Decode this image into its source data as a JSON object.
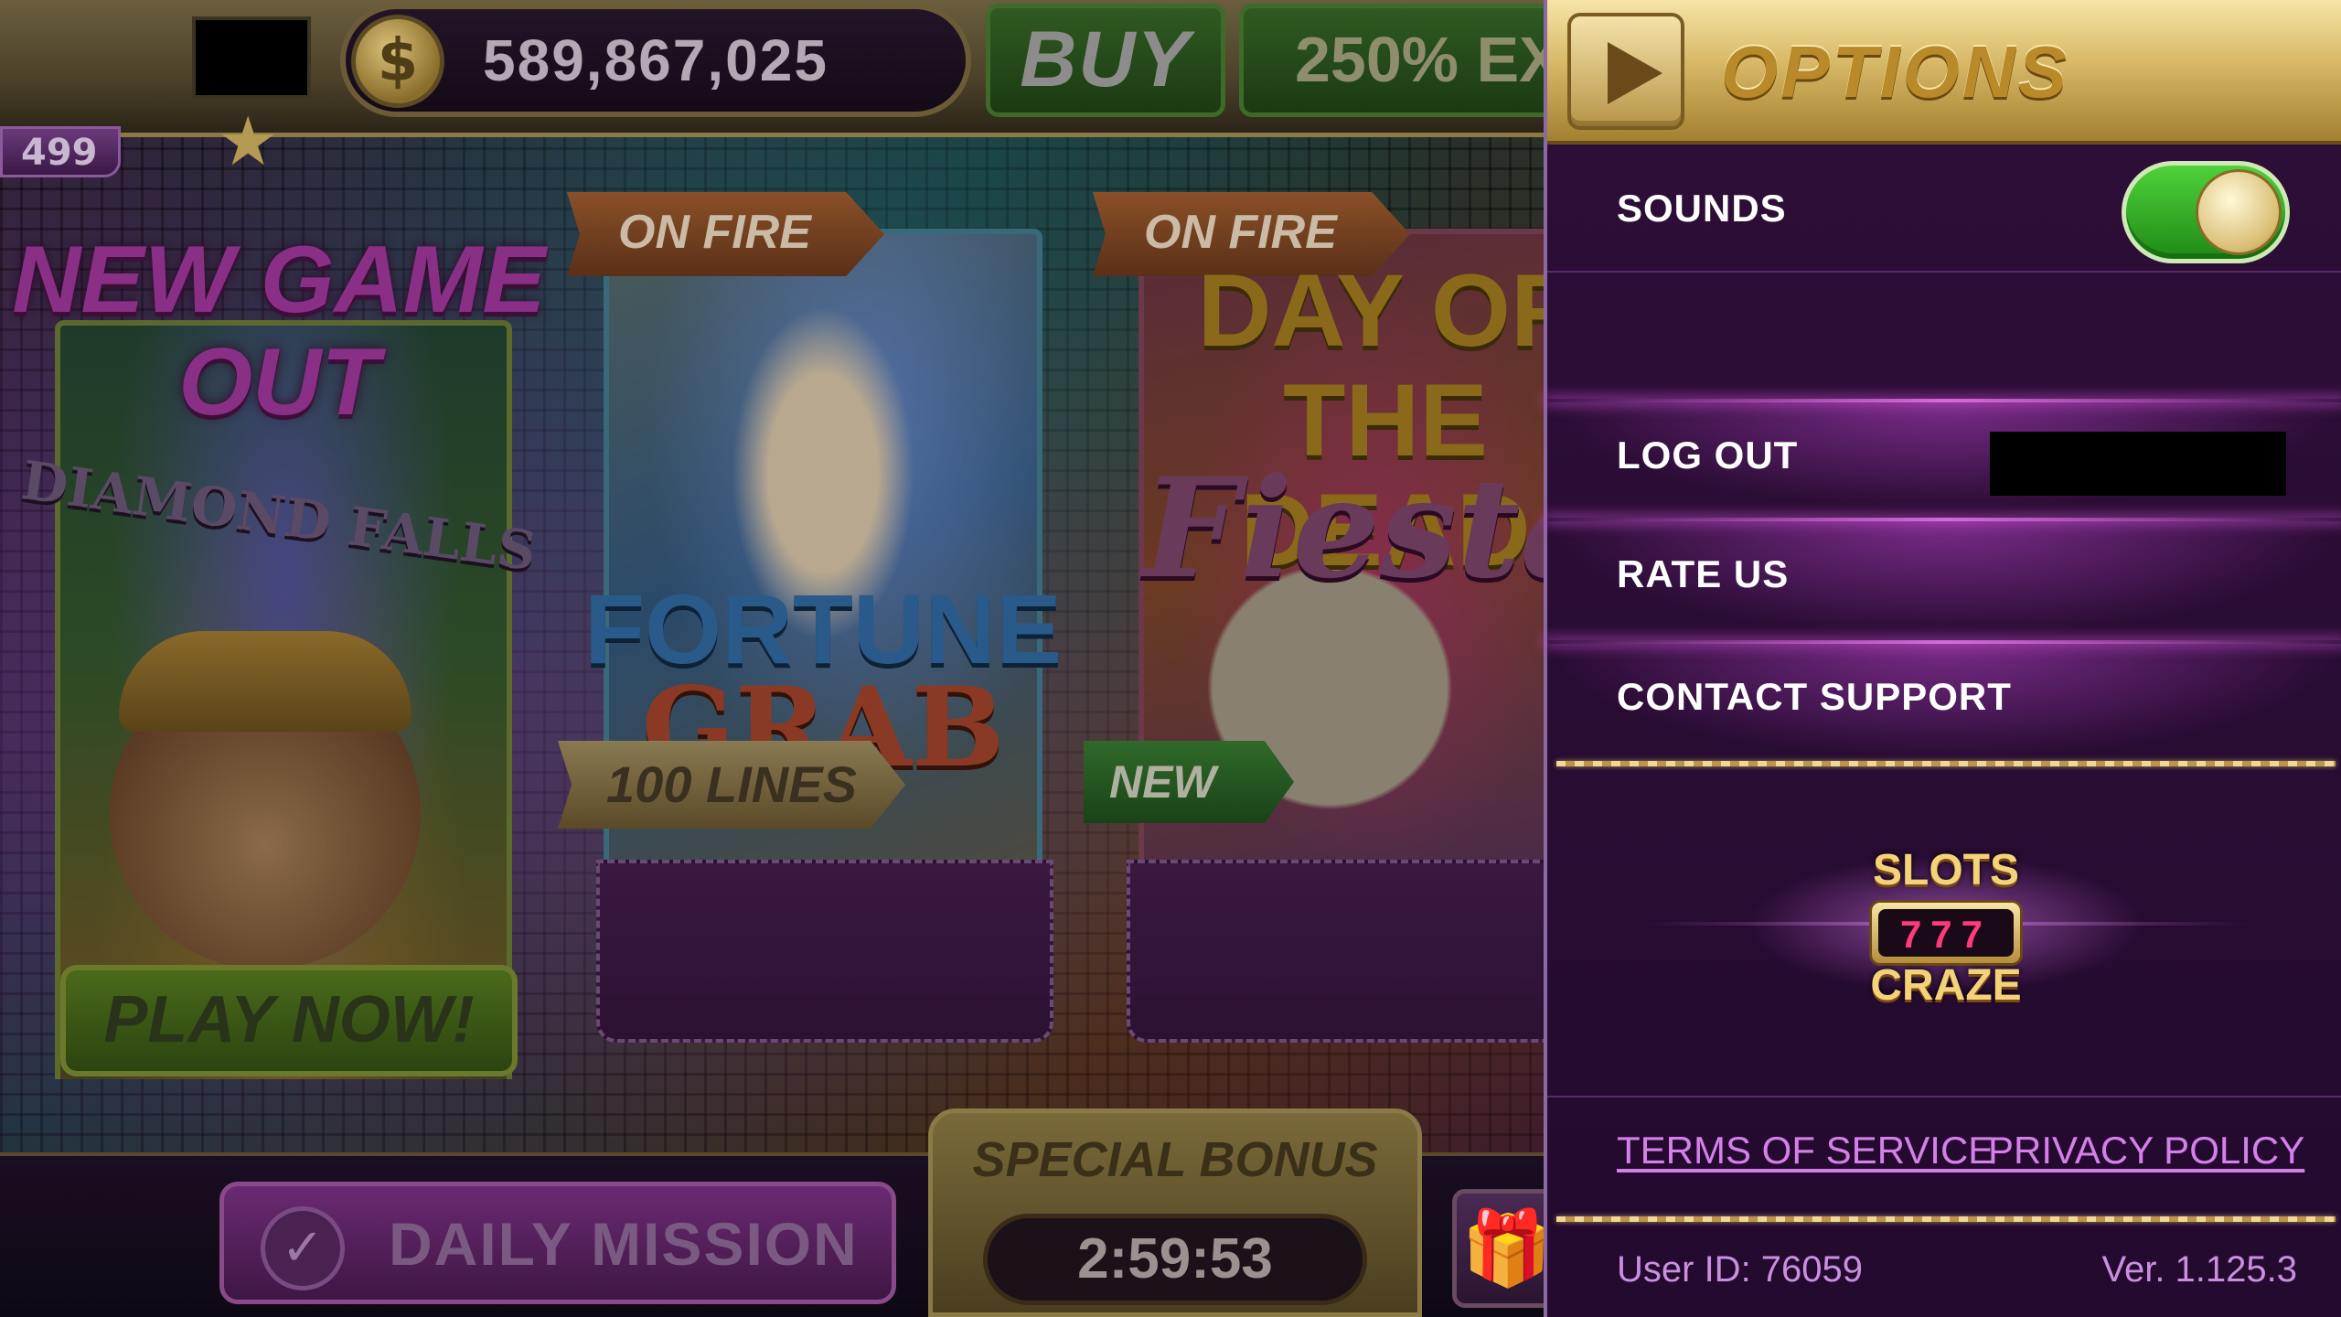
{
  "lobby": {
    "coins": "589,867,025",
    "coin_symbol": "$",
    "level": "499",
    "buy_label": "BUY",
    "extra_offer": "250% EX",
    "games": [
      {
        "promo_top": "NEW GAME OUT",
        "title": "DIAMOND FALLS",
        "button": "PLAY NOW!"
      },
      {
        "ribbon": "ON FIRE",
        "title_line1": "FORTUNE",
        "title_line2": "GRAB",
        "badge": "100 LINES"
      },
      {
        "ribbon": "ON FIRE",
        "title_line1": "DAY OF",
        "title_line2": "THE DEAD",
        "title_script": "Fiesta",
        "badge": "NEW"
      }
    ],
    "daily_mission": "DAILY MISSION",
    "special_bonus": "SPECIAL BONUS",
    "bonus_timer": "2:59:53"
  },
  "options": {
    "title": "OPTIONS",
    "sounds_label": "SOUNDS",
    "sounds_on": true,
    "logout_label": "LOG OUT",
    "rate_label": "RATE US",
    "support_label": "CONTACT SUPPORT",
    "logo": {
      "top": "SLOTS",
      "reel": "777",
      "bottom": "CRAZE"
    },
    "terms_label": "TERMS OF SERVICE",
    "privacy_label": "PRIVACY POLICY",
    "user_id": "User ID: 76059",
    "version": "Ver. 1.125.3"
  },
  "colors": {
    "panel_bg": "#2e0e38",
    "header_gold": "#d7b866",
    "toggle_on": "#4fd23a",
    "link": "#d580ea"
  }
}
